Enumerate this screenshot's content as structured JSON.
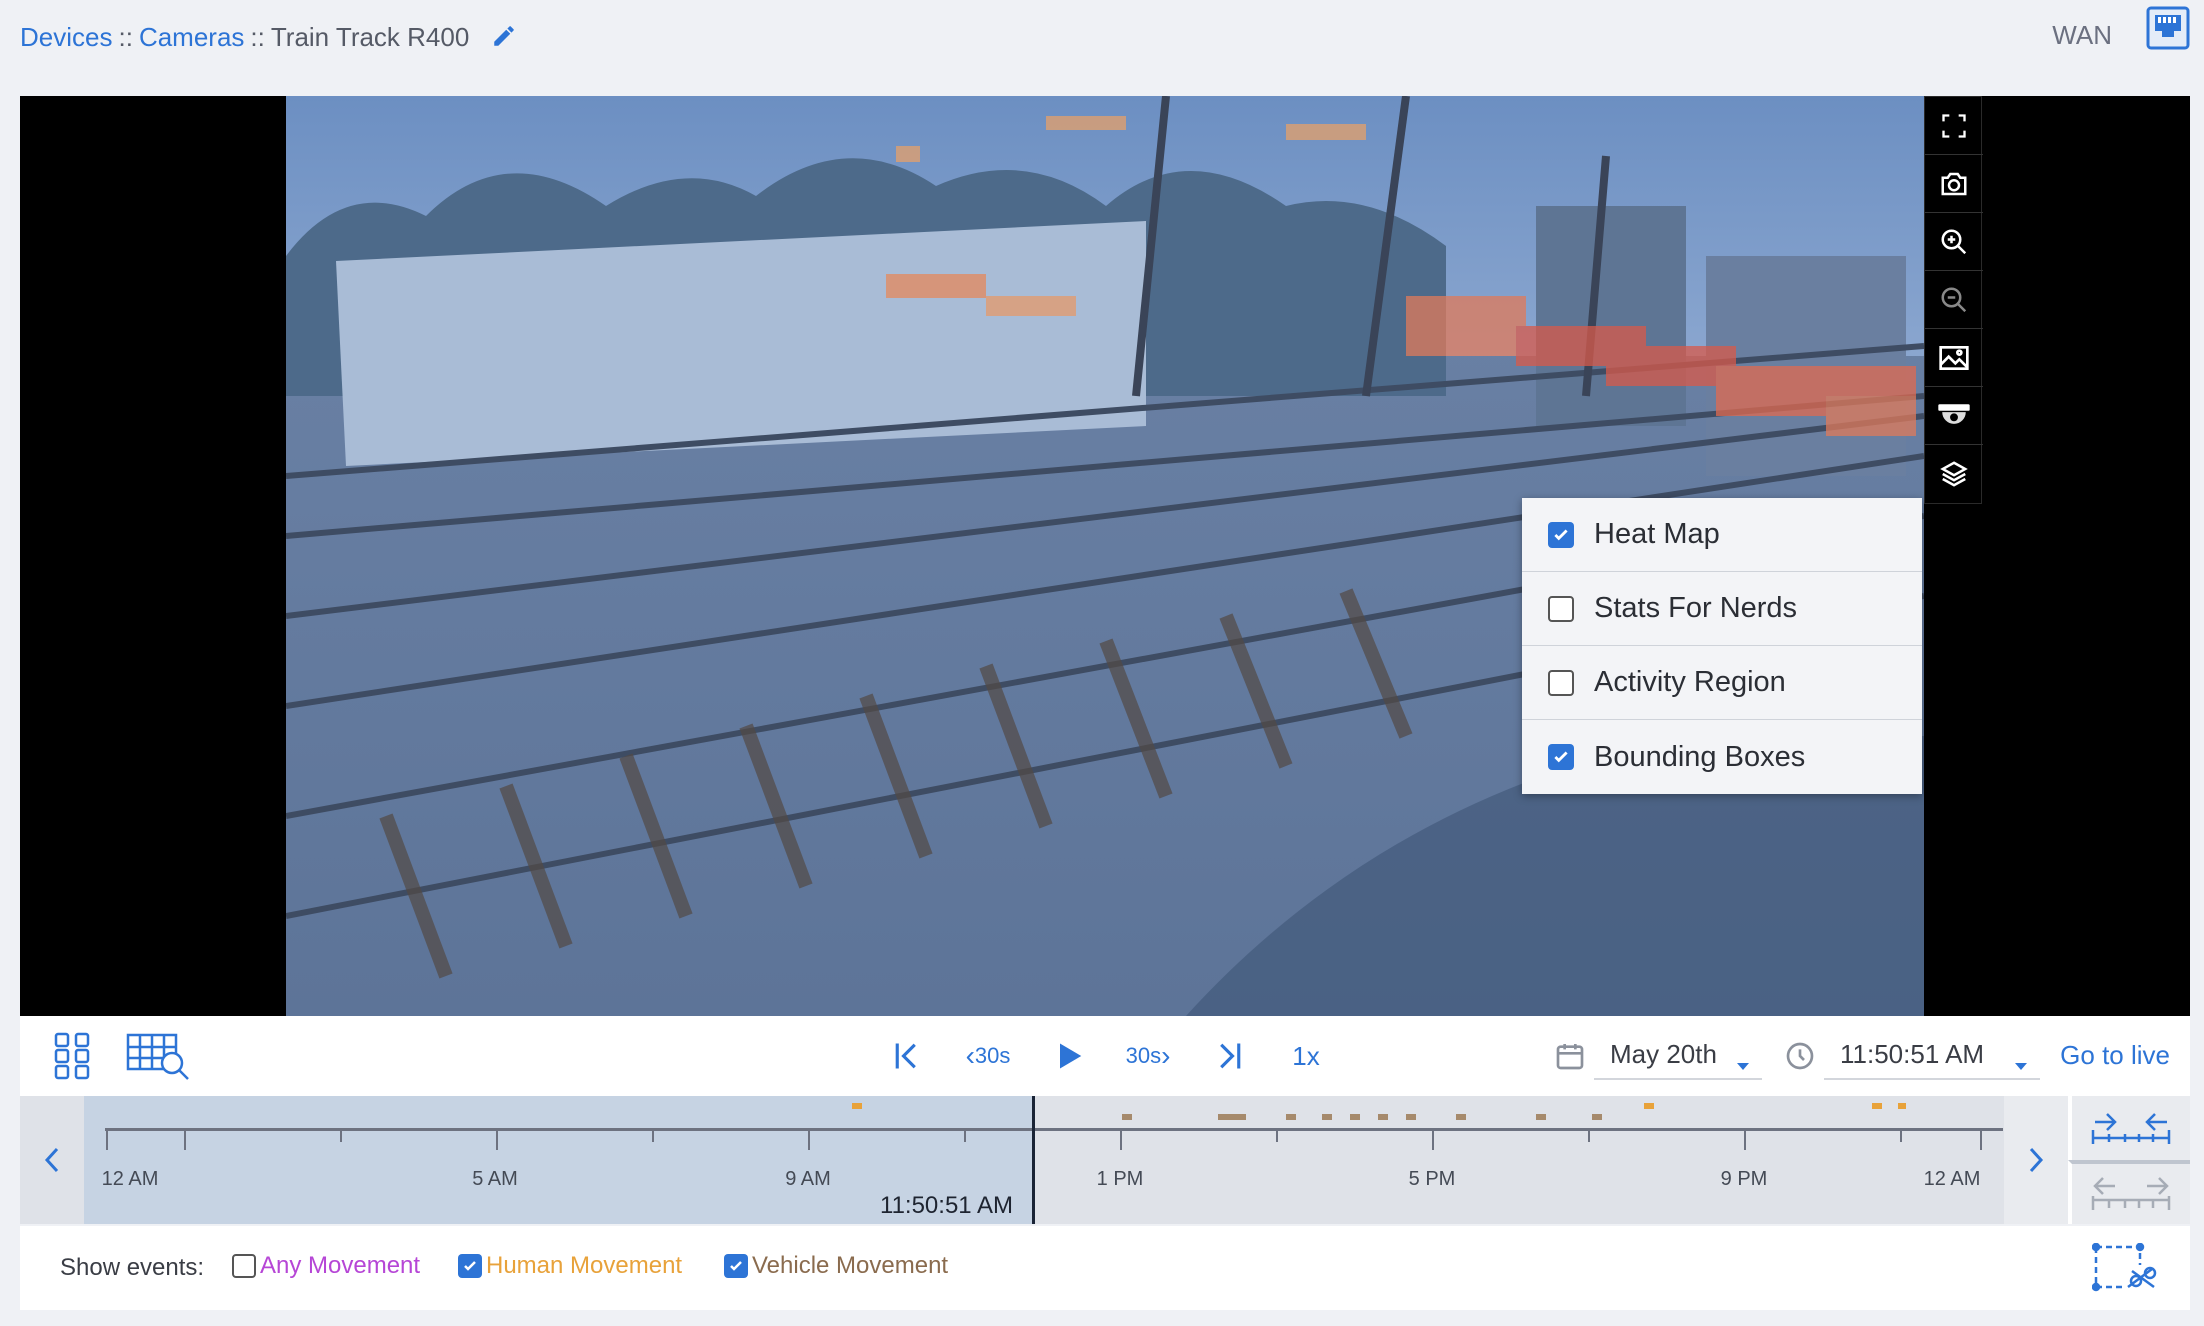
{
  "breadcrumb": {
    "devices": "Devices",
    "cameras": "Cameras",
    "separator": "::",
    "current": "Train Track R400"
  },
  "header": {
    "network_label": "WAN",
    "network_icon": "ethernet-port-icon"
  },
  "player": {
    "toolbar_icons": [
      "fullscreen-icon",
      "snapshot-camera-icon",
      "zoom-in-icon",
      "zoom-out-icon",
      "image-icon",
      "dome-camera-icon",
      "layers-icon"
    ],
    "layers_menu": [
      {
        "label": "Heat Map",
        "checked": true
      },
      {
        "label": "Stats For Nerds",
        "checked": false
      },
      {
        "label": "Activity Region",
        "checked": false
      },
      {
        "label": "Bounding Boxes",
        "checked": true
      }
    ]
  },
  "controls": {
    "grid_icon": "grid-view-icon",
    "search_icon": "grid-search-icon",
    "skip_back_label": "30s",
    "skip_forward_label": "30s",
    "speed": "1x",
    "date": "May 20th",
    "time": "11:50:51 AM",
    "go_live": "Go to live"
  },
  "timeline": {
    "tick_labels": [
      "12 AM",
      "5 AM",
      "9 AM",
      "1 PM",
      "5 PM",
      "9 PM",
      "12 AM"
    ],
    "cursor_time": "11:50:51 AM"
  },
  "events": {
    "label": "Show events:",
    "filters": [
      {
        "label": "Any Movement",
        "checked": false,
        "color": "#b646d6"
      },
      {
        "label": "Human Movement",
        "checked": true,
        "color": "#e8a23a"
      },
      {
        "label": "Vehicle Movement",
        "checked": true,
        "color": "#8a6b4e"
      }
    ]
  },
  "colors": {
    "accent": "#2d74d6",
    "human_event": "#e8a23a",
    "vehicle_event": "#a68a6c"
  }
}
